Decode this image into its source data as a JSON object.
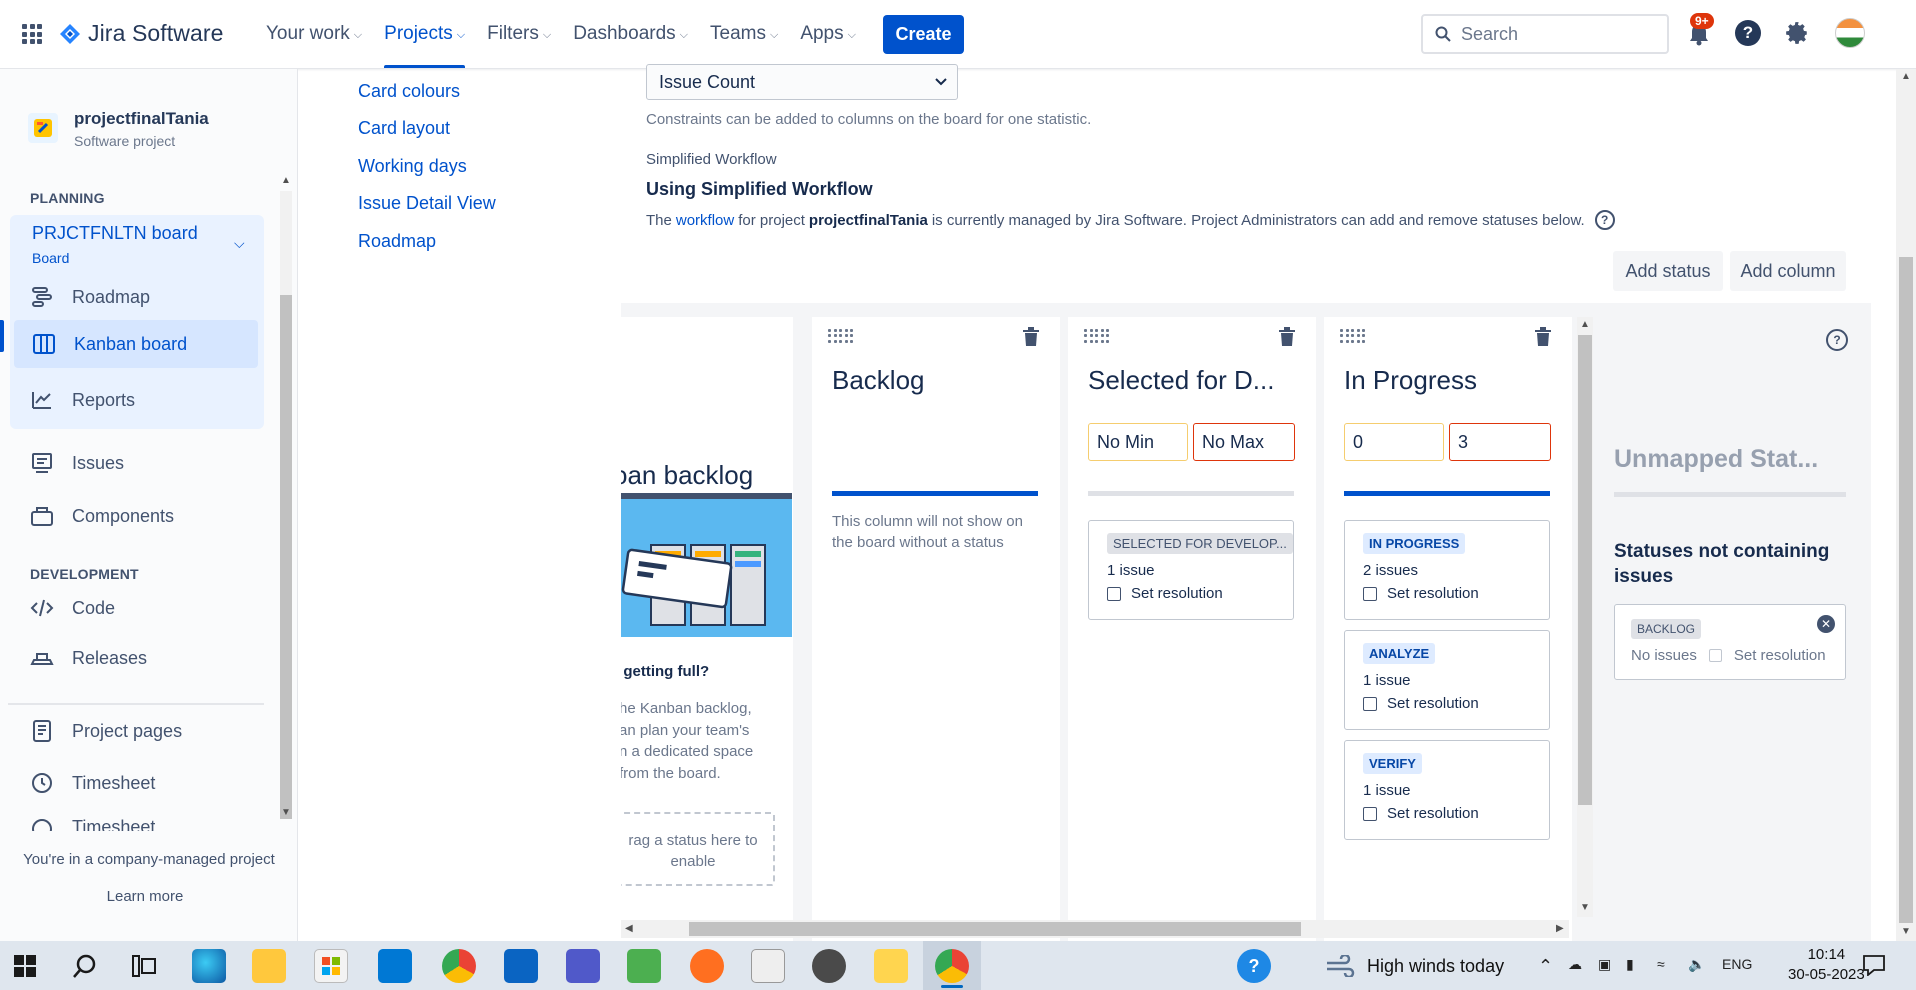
{
  "topnav": {
    "logo_text": "Jira Software",
    "items": [
      {
        "label": "Your work",
        "active": false
      },
      {
        "label": "Projects",
        "active": true
      },
      {
        "label": "Filters",
        "active": false
      },
      {
        "label": "Dashboards",
        "active": false
      },
      {
        "label": "Teams",
        "active": false
      },
      {
        "label": "Apps",
        "active": false
      }
    ],
    "create_label": "Create",
    "search_placeholder": "Search",
    "notification_badge": "9+"
  },
  "sidebar": {
    "project_name": "projectfinalTania",
    "project_type": "Software project",
    "planning_label": "PLANNING",
    "board_title": "PRJCTFNLTN board",
    "board_subtitle": "Board",
    "planning_items": [
      "Roadmap",
      "Kanban board",
      "Reports"
    ],
    "other_items": [
      "Issues",
      "Components"
    ],
    "development_label": "DEVELOPMENT",
    "development_items": [
      "Code",
      "Releases"
    ],
    "bottom_items": [
      "Project pages",
      "Timesheet",
      "Timesheet"
    ],
    "footer_text": "You're in a company-managed project",
    "learn_more": "Learn more"
  },
  "settings_nav": {
    "items": [
      "Card colours",
      "Card layout",
      "Working days",
      "Issue Detail View",
      "Roadmap"
    ]
  },
  "column_config": {
    "constraint_select": "Issue Count",
    "constraint_hint": "Constraints can be added to columns on the board for one statistic.",
    "workflow_label": "Simplified Workflow",
    "workflow_title": "Using Simplified Workflow",
    "workflow_desc_1": "The",
    "workflow_link": "workflow",
    "workflow_desc_2": "for project",
    "workflow_project": "projectfinalTania",
    "workflow_desc_3": "is currently managed by Jira Software. Project Administrators can add and remove statuses below.",
    "add_status_label": "Add status",
    "add_column_label": "Add column"
  },
  "kanban_backlog": {
    "title": "oan backlog",
    "question": "l getting full?",
    "text_lines": [
      "he Kanban backlog,",
      "an plan your team's",
      "n a dedicated space",
      "from the board."
    ],
    "drop_lines": [
      "rag a status here to",
      "enable"
    ]
  },
  "columns": [
    {
      "title": "Backlog",
      "note": "This column will not show on the board without a status"
    },
    {
      "title": "Selected for D...",
      "min": "No Min",
      "max": "No Max",
      "statuses": [
        {
          "name": "SELECTED FOR DEVELOP...",
          "count": "1 issue",
          "resolution": "Set resolution"
        }
      ]
    },
    {
      "title": "In Progress",
      "min": "0",
      "max": "3",
      "statuses": [
        {
          "name": "IN PROGRESS",
          "count": "2 issues",
          "resolution": "Set resolution"
        },
        {
          "name": "ANALYZE",
          "count": "1 issue",
          "resolution": "Set resolution"
        },
        {
          "name": "VERIFY",
          "count": "1 issue",
          "resolution": "Set resolution"
        }
      ]
    }
  ],
  "unmapped": {
    "title": "Unmapped Stat...",
    "subtitle": "Statuses not containing issues",
    "status_name": "BACKLOG",
    "count": "No issues",
    "resolution": "Set resolution"
  },
  "taskbar": {
    "weather": "High winds today",
    "lang": "ENG",
    "time": "10:14",
    "date": "30-05-2023"
  },
  "colors": {
    "brand": "#0052cc",
    "bar_blue": "#0052cc",
    "bar_grey": "#dfe1e6",
    "min_border": "#f5cd6f",
    "max_border": "#de350b"
  }
}
